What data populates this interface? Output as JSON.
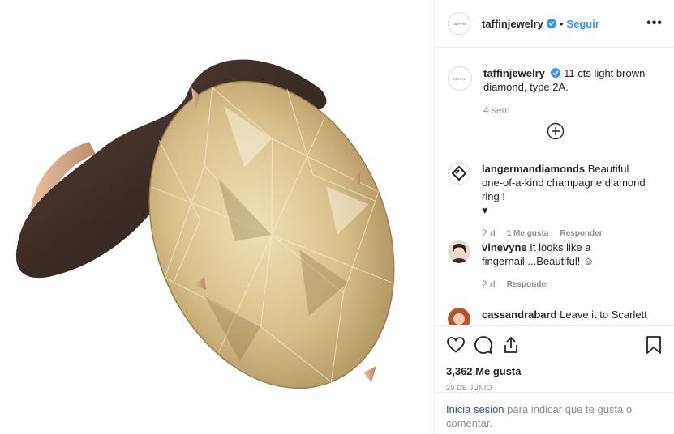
{
  "header": {
    "avatar_text": "TAFFIN",
    "username": "taffinjewelry",
    "separator": "•",
    "follow_label": "Seguir",
    "more_label": "•••"
  },
  "caption": {
    "username": "taffinjewelry",
    "text": "11 cts light brown diamond, type 2A.",
    "time": "4 sem"
  },
  "comments": [
    {
      "username": "langermandiamonds",
      "text": "Beautiful one-of-a-kind champagne diamond ring !",
      "heart": "♥",
      "time": "2 d",
      "likes": "1 Me gusta",
      "reply": "Responder"
    },
    {
      "username": "vinevyne",
      "text": "It looks like a fingernail....Beautiful! ☺",
      "time": "2 d",
      "reply": "Responder"
    },
    {
      "username": "cassandrabard",
      "text": "Leave it to Scarlett"
    }
  ],
  "actions": {
    "likes": "3,362 Me gusta",
    "date": "29 DE JUNIO"
  },
  "login": {
    "link": "Inicia sesión",
    "text": "para indicar que te gusta o comentar."
  },
  "colors": {
    "link_blue": "#3897f0",
    "login_blue": "#385185",
    "muted": "#8e8e8e",
    "border": "#efefef"
  }
}
